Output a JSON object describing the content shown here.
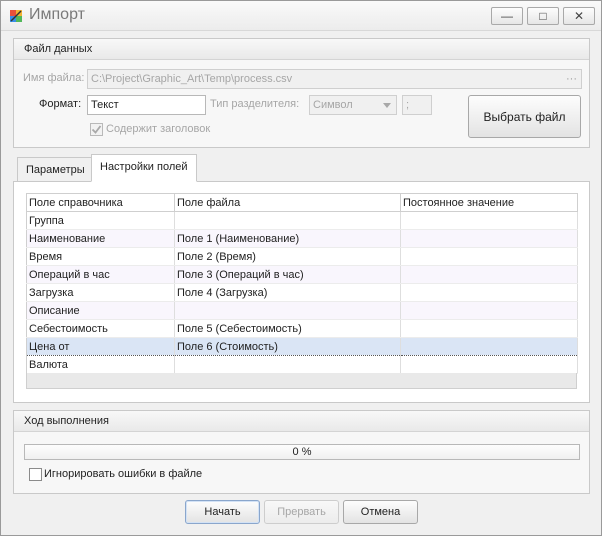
{
  "window": {
    "title": "Импорт",
    "controls": {
      "minimize": "—",
      "maximize": "□",
      "close": "✕"
    }
  },
  "file_group": {
    "header": "Файл данных",
    "file_name_label": "Имя файла:",
    "file_name_value": "C:\\Project\\Graphic_Art\\Temp\\process.csv",
    "browse_dots": "···",
    "format_label": "Формат:",
    "format_value": "Текст",
    "delimiter_type_label": "Тип разделителя:",
    "delimiter_type_value": "Символ",
    "delimiter_value": ";",
    "has_header_label": "Содержит заголовок",
    "has_header_checked": true,
    "choose_file_button": "Выбрать файл"
  },
  "tabs": [
    {
      "label": "Параметры",
      "active": false
    },
    {
      "label": "Настройки полей",
      "active": true
    }
  ],
  "grid": {
    "columns": [
      "Поле справочника",
      "Поле файла",
      "Постоянное значение"
    ],
    "rows": [
      {
        "ref": "Группа",
        "file": "",
        "const": ""
      },
      {
        "ref": "Наименование",
        "file": "Поле 1 (Наименование)",
        "const": ""
      },
      {
        "ref": "Время",
        "file": "Поле 2 (Время)",
        "const": ""
      },
      {
        "ref": "Операций в час",
        "file": "Поле 3 (Операций в час)",
        "const": ""
      },
      {
        "ref": "Загрузка",
        "file": "Поле 4 (Загрузка)",
        "const": ""
      },
      {
        "ref": "Описание",
        "file": "",
        "const": ""
      },
      {
        "ref": "Себестоимость",
        "file": "Поле 5 (Себестоимость)",
        "const": ""
      },
      {
        "ref": "Цена от",
        "file": "Поле 6 (Стоимость)",
        "const": ""
      },
      {
        "ref": "Валюта",
        "file": "",
        "const": ""
      }
    ],
    "selected_row": 7
  },
  "progress_group": {
    "header": "Ход выполнения",
    "progress_text": "0 %",
    "progress_fraction": 0,
    "ignore_errors_label": "Игнорировать ошибки в файле",
    "ignore_errors_checked": false
  },
  "buttons": {
    "start": "Начать",
    "abort": "Прервать",
    "cancel": "Отмена"
  }
}
